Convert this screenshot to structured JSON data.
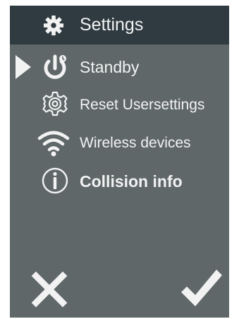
{
  "header": {
    "title": "Settings",
    "icon": "gear-icon"
  },
  "menu": {
    "items": [
      {
        "label": "Standby",
        "icon": "power-icon",
        "selected": true
      },
      {
        "label": "Reset Usersettings",
        "icon": "gear-outline-icon",
        "selected": false
      },
      {
        "label": "Wireless devices",
        "icon": "wifi-icon",
        "selected": false
      },
      {
        "label": "Collision info",
        "icon": "info-icon",
        "selected": false
      }
    ]
  },
  "footer": {
    "cancel_icon": "close-icon",
    "confirm_icon": "checkmark-icon"
  },
  "colors": {
    "background": "#5f6769",
    "header": "#2f3b41",
    "foreground": "#f2f2f2"
  }
}
